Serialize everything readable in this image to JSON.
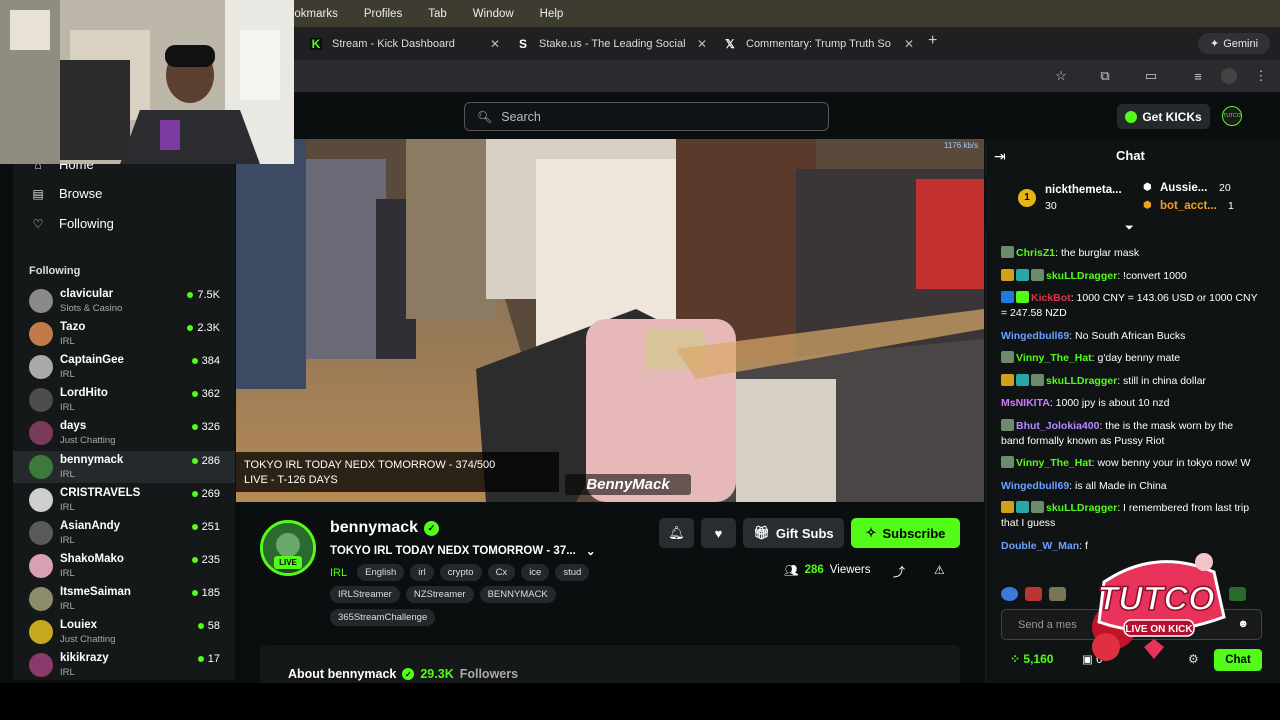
{
  "menubar": {
    "items": [
      "ookmarks",
      "Profiles",
      "Tab",
      "Window",
      "Help"
    ]
  },
  "tabs": [
    {
      "title": "Stream - Kick Dashboard",
      "icon": "kick-icon"
    },
    {
      "title": "Stake.us - The Leading Social",
      "icon": "stake-icon"
    },
    {
      "title": "Commentary: Trump Truth So",
      "icon": "x-icon"
    }
  ],
  "gemini_label": "Gemini",
  "search": {
    "placeholder": "Search"
  },
  "get_kicks_label": "Get KICKs",
  "user_avatar_label": "TUTCO",
  "nav": {
    "home": "Home",
    "browse": "Browse",
    "following": "Following"
  },
  "following_title": "Following",
  "following": [
    {
      "name": "clavicular",
      "category": "Slots & Casino",
      "viewers": "7.5K",
      "color": "#8a8a8a"
    },
    {
      "name": "Tazo",
      "category": "IRL",
      "viewers": "2.3K",
      "color": "#c27a4a"
    },
    {
      "name": "CaptainGee",
      "category": "IRL",
      "viewers": "384",
      "color": "#a9a9a9"
    },
    {
      "name": "LordHito",
      "category": "IRL",
      "viewers": "362",
      "color": "#4d4d4d"
    },
    {
      "name": "days",
      "category": "Just Chatting",
      "viewers": "326",
      "color": "#7a3a5a"
    },
    {
      "name": "bennymack",
      "category": "IRL",
      "viewers": "286",
      "color": "#3b7a3b"
    },
    {
      "name": "CRISTRAVELS",
      "category": "IRL",
      "viewers": "269",
      "color": "#cfcfcf"
    },
    {
      "name": "AsianAndy",
      "category": "IRL",
      "viewers": "251",
      "color": "#5a5a5a"
    },
    {
      "name": "ShakoMako",
      "category": "IRL",
      "viewers": "235",
      "color": "#d8a0b0"
    },
    {
      "name": "ItsmeSaiman",
      "category": "IRL",
      "viewers": "185",
      "color": "#8c8c6a"
    },
    {
      "name": "Louiex",
      "category": "Just Chatting",
      "viewers": "58",
      "color": "#c8a820"
    },
    {
      "name": "kikikrazy",
      "category": "IRL",
      "viewers": "17",
      "color": "#8a3a6a"
    }
  ],
  "video": {
    "overlay_line1": "TOKYO IRL TODAY NEDX TOMORROW - 374/500",
    "overlay_line2": "LIVE - T-126 DAYS",
    "watermark": "BennyMack",
    "bitrate": "1176 kb/s"
  },
  "channel": {
    "name": "bennymack",
    "live_label": "LIVE",
    "title": "TOKYO IRL TODAY NEDX TOMORROW - 37...",
    "category": "IRL",
    "tags_row1": [
      "English",
      "irl",
      "crypto",
      "Cx",
      "ice",
      "stud"
    ],
    "tags_row2": [
      "IRLStreamer",
      "NZStreamer",
      "BENNYMACK"
    ],
    "tags_row3": [
      "365StreamChallenge"
    ],
    "gift_label": "Gift Subs",
    "subscribe_label": "Subscribe",
    "viewers_count": "286",
    "viewers_label": "Viewers",
    "about_label": "About bennymack",
    "followers_count": "29.3K",
    "followers_label": "Followers"
  },
  "chat": {
    "title": "Chat",
    "top_gifters": [
      {
        "rank": "1",
        "name": "nickthemeta...",
        "count": "30"
      },
      {
        "name": "Aussie...",
        "count": "20"
      },
      {
        "name": "bot_acct...",
        "count": "1"
      }
    ],
    "messages": [
      {
        "user": "ChrisZ1",
        "color": "#53fc18",
        "text": "the burglar mask",
        "badges": [
          "#6c8a6c"
        ]
      },
      {
        "user": "skuLLDragger",
        "color": "#53fc18",
        "text": "!convert 1000",
        "badges": [
          "#d4a017",
          "#2aa6a6",
          "#6c8a6c"
        ]
      },
      {
        "user": "KickBot",
        "color": "#e0304a",
        "text": "1000 CNY = 143.06 USD or 1000 CNY = 247.58 NZD",
        "badges": [
          "#1f7ae0",
          "#53fc18"
        ]
      },
      {
        "user": "Wingedbull69",
        "color": "#6aa0ff",
        "text": "No South African Bucks",
        "badges": []
      },
      {
        "user": "Vinny_The_Hat",
        "color": "#53fc18",
        "text": "g'day benny mate",
        "badges": [
          "#6c8a6c"
        ]
      },
      {
        "user": "skuLLDragger",
        "color": "#53fc18",
        "text": "still in china dollar",
        "badges": [
          "#d4a017",
          "#2aa6a6",
          "#6c8a6c"
        ]
      },
      {
        "user": "MsNIKITA",
        "color": "#d07aff",
        "text": "1000 jpy is about 10 nzd",
        "badges": []
      },
      {
        "user": "Bhut_Jolokia400",
        "color": "#b48aff",
        "text": "the is the mask worn by the band formally known as Pussy Riot",
        "badges": [
          "#6c8a6c"
        ]
      },
      {
        "user": "Vinny_The_Hat",
        "color": "#53fc18",
        "text": "wow benny your in tokyo now! W",
        "badges": [
          "#6c8a6c"
        ]
      },
      {
        "user": "Wingedbull69",
        "color": "#6aa0ff",
        "text": "is all Made in China",
        "badges": []
      },
      {
        "user": "skuLLDragger",
        "color": "#53fc18",
        "text": "I remembered from last trip that I guess",
        "badges": [
          "#d4a017",
          "#2aa6a6",
          "#6c8a6c"
        ]
      },
      {
        "user": "Double_W_Man",
        "color": "#6aa0ff",
        "text": "f",
        "badges": []
      }
    ],
    "input_placeholder": "Send a mes",
    "points": "5,160",
    "zero": "0",
    "send_label": "Chat",
    "overlay_logo_text": "TUTCO",
    "overlay_logo_sub": "LIVE ON KICK"
  }
}
